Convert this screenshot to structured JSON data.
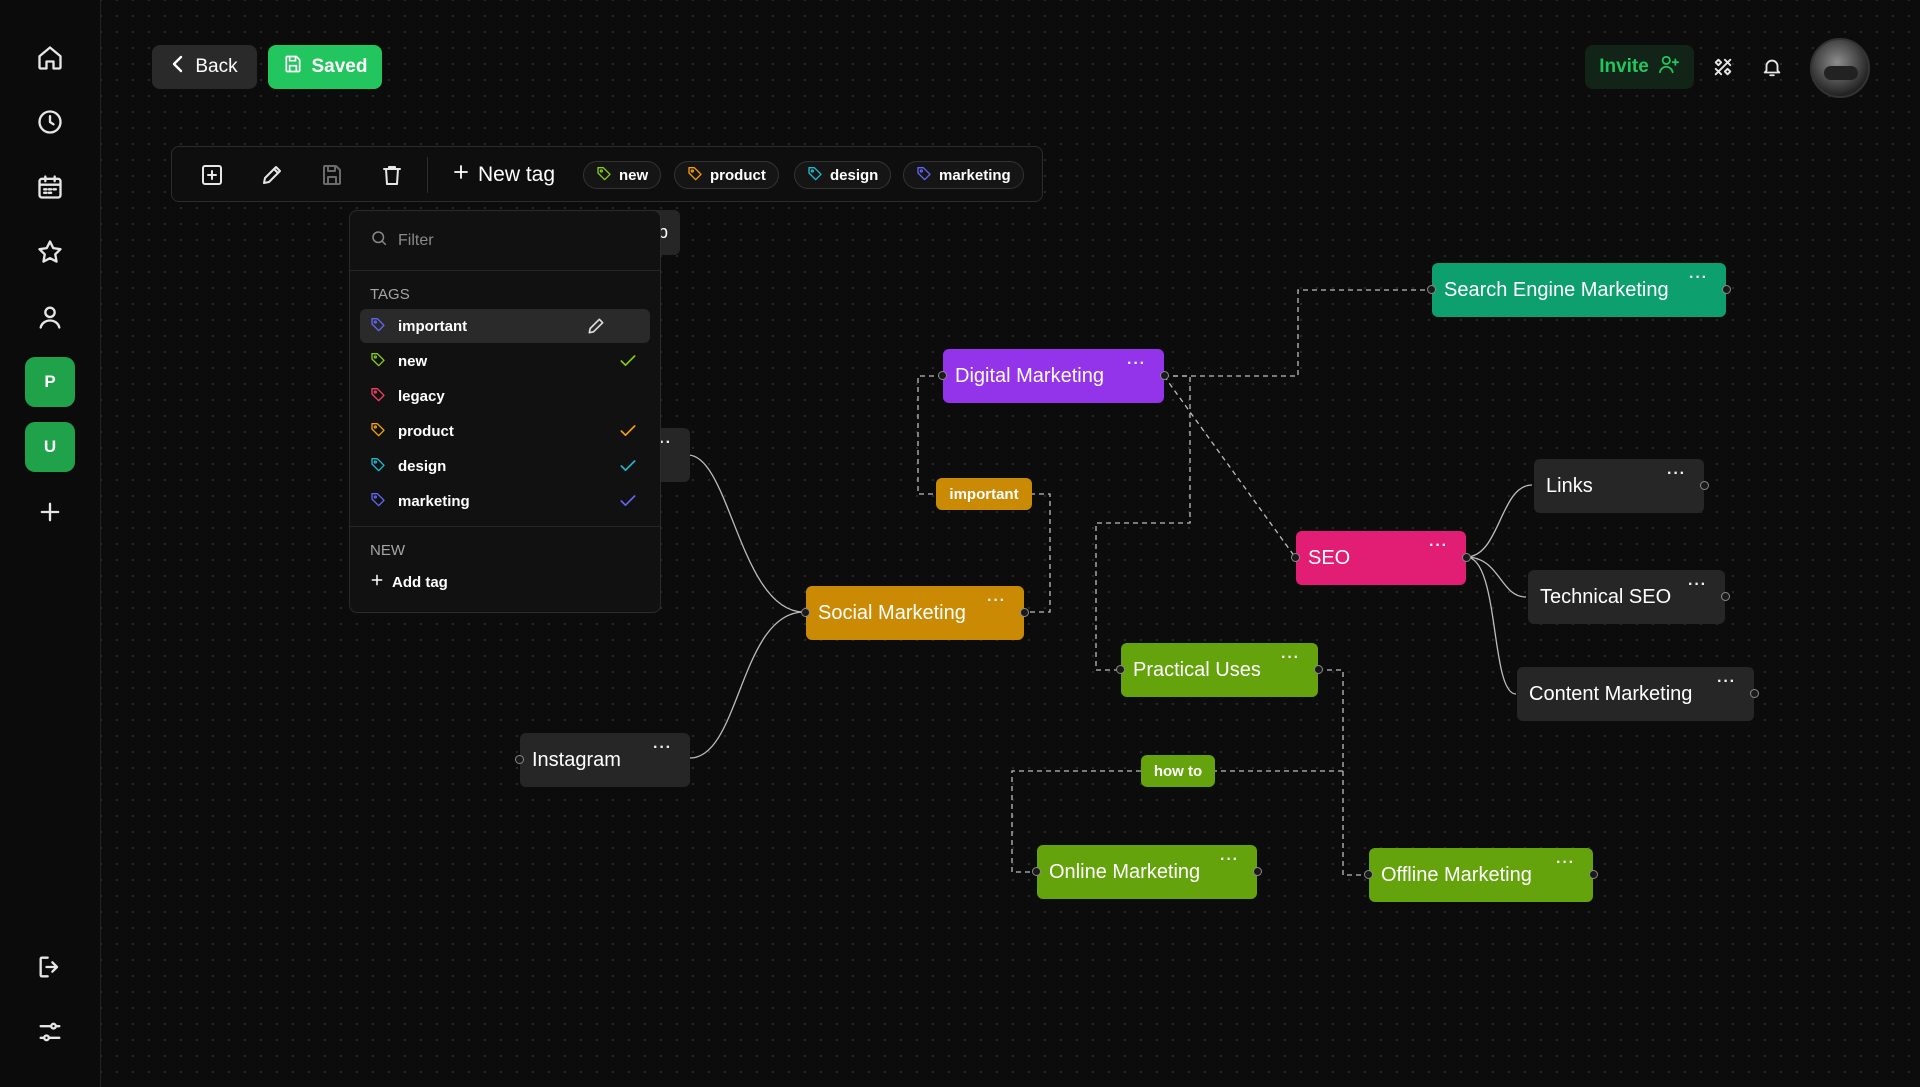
{
  "header": {
    "back_label": "Back",
    "saved_label": "Saved",
    "invite_label": "Invite"
  },
  "sidebar": {
    "workspaces": [
      "P",
      "U"
    ],
    "icons": [
      "home-icon",
      "clock-icon",
      "calendar-icon",
      "star-icon",
      "user-icon",
      "plus-icon",
      "logout-icon",
      "settings-sliders-icon"
    ]
  },
  "toolbar": {
    "new_tag_label": "New tag",
    "chips": [
      {
        "label": "new",
        "color": "#84cc16"
      },
      {
        "label": "product",
        "color": "#f59e0b"
      },
      {
        "label": "design",
        "color": "#22b8cf"
      },
      {
        "label": "marketing",
        "color": "#6366f1"
      }
    ]
  },
  "tag_dropdown": {
    "filter_placeholder": "Filter",
    "tags_heading": "TAGS",
    "new_heading": "NEW",
    "add_tag_label": "Add tag",
    "tags": [
      {
        "label": "important",
        "color": "#6366f1",
        "checked": false,
        "active": true
      },
      {
        "label": "new",
        "color": "#84cc16",
        "checked": true
      },
      {
        "label": "legacy",
        "color": "#f43f5e",
        "checked": false
      },
      {
        "label": "product",
        "color": "#f59e0b",
        "checked": true
      },
      {
        "label": "design",
        "color": "#22b8cf",
        "checked": true
      },
      {
        "label": "marketing",
        "color": "#6366f1",
        "checked": true
      }
    ]
  },
  "mindmap": {
    "nodes": {
      "search_engine_marketing": "Search Engine Marketing",
      "digital_marketing": "Digital Marketing",
      "links": "Links",
      "seo": "SEO",
      "technical_seo": "Technical SEO",
      "content_marketing": "Content Marketing",
      "social_marketing": "Social Marketing",
      "practical_uses": "Practical Uses",
      "instagram": "Instagram",
      "online_marketing": "Online Marketing",
      "offline_marketing": "Offline Marketing",
      "hidden_node_fragment": "p"
    },
    "edge_labels": {
      "important": "important",
      "how_to": "how to"
    },
    "more_glyph": "···",
    "colors": {
      "purple": "#9333ea",
      "teal": "#0e9f6e",
      "pink": "#e11d74",
      "amber": "#ca8a04",
      "green": "#65a30d",
      "dark": "#262626"
    }
  }
}
